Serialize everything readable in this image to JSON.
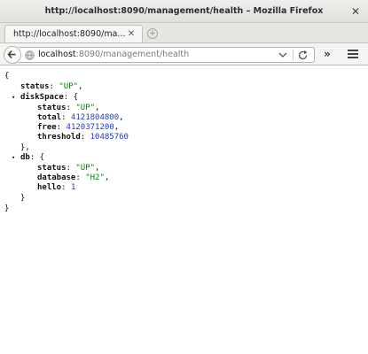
{
  "window": {
    "title": "http://localhost:8090/management/health – Mozilla Firefox"
  },
  "tab": {
    "label": "http://localhost:8090/ma..."
  },
  "urlbar": {
    "host": "localhost",
    "rest": ":8090/management/health"
  },
  "json": {
    "open_brace": "{",
    "close_brace": "}",
    "status_key": "status",
    "status_value": "\"UP\"",
    "diskspace_key": "diskSpace",
    "diskspace_close": "},",
    "disk_status_key": "status",
    "disk_status_value": "\"UP\"",
    "total_key": "total",
    "total_value": "4121804800",
    "free_key": "free",
    "free_value": "4120371200",
    "threshold_key": "threshold",
    "threshold_value": "10485760",
    "db_key": "db",
    "db_close": "}",
    "db_status_key": "status",
    "db_status_value": "\"UP\"",
    "database_key": "database",
    "database_value": "\"H2\"",
    "hello_key": "hello",
    "hello_value": "1"
  },
  "icons": {
    "close": "close-icon",
    "back": "back-arrow-icon",
    "globe": "globe-icon",
    "reload": "reload-icon",
    "menu": "hamburger-menu-icon"
  },
  "colors": {
    "string": "#0a7d0a",
    "number": "#1f3bc9"
  }
}
